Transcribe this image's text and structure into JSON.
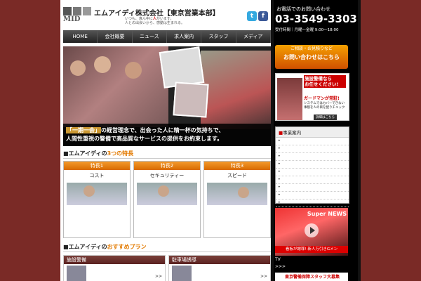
{
  "header": {
    "company": "エムアイディ株式会社【東京営業本部】",
    "logo_text": "MID",
    "tagline_prefix": "いつも、真ん中に",
    "tagline_highlight": "人",
    "tagline_suffix": "がいます。",
    "tagline_line2": "人との出会いから、感動は生まれる。",
    "twitter": "t",
    "facebook": "f"
  },
  "nav": [
    "HOME",
    "会社概要",
    "ニュース",
    "求人案内",
    "スタッフ",
    "メディア"
  ],
  "hero": {
    "highlight": "「一期一会」",
    "line1": "の経営理念で、出会った人に精一杯の気持ちで、",
    "line2": "人間性重視の警備で高品質なサービスの提供をお約束します。"
  },
  "features_section": {
    "prefix": "■エムアイディの",
    "highlight": "3つの特長",
    "items": [
      {
        "tab": "特長1",
        "label": "コスト"
      },
      {
        "tab": "特長2",
        "label": "セキュリティー"
      },
      {
        "tab": "特長3",
        "label": "スピード"
      }
    ]
  },
  "plans_section": {
    "prefix": "■エムアイディの",
    "highlight": "おすすめプラン",
    "items": [
      {
        "title": "施設警備",
        "arrow": ">>"
      },
      {
        "title": "駐車場誘導",
        "arrow": ">>"
      }
    ]
  },
  "right": {
    "phone_label": "お電話でのお問い合わせ",
    "phone": "03-3549-3303",
    "hours": "受付時間｜月曜〜金曜 9:00〜18:00",
    "contact_line1": "ご相談・お見積りなど",
    "contact_line2": "お問い合わせはこちら",
    "ad_line1": "施設警備なら",
    "ad_line2": "お任せください!",
    "ad_line3": "ガードマンが常駐!",
    "ad_line4": "システムではカバーできない事態を人の目を配りチェック",
    "ad_button": "詳細はこちら",
    "biz_title": "事業案内",
    "biz_mark": "■",
    "biz_items": [
      "•",
      "•",
      "•",
      "•",
      "•",
      "•",
      "•",
      "•",
      "•"
    ],
    "tv_news": "Super NEWS",
    "tv_band": "看板が謝罪! 新人万引きGメン",
    "tv_label": "TV",
    "tv_arrow": ">>>",
    "bottom_text": "東京警備保障スタッフ大募集"
  }
}
